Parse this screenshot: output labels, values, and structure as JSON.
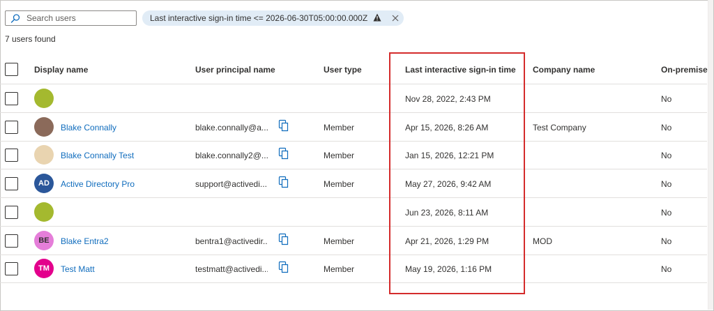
{
  "search": {
    "placeholder": "Search users",
    "icon": "search-icon"
  },
  "filter": {
    "text": "Last interactive sign-in time <= 2026-06-30T05:00:00.000Z",
    "warning_icon": "warning-icon",
    "close_icon": "close-icon"
  },
  "summary": {
    "count_text": "7 users found"
  },
  "columns": {
    "display_name": "Display name",
    "upn": "User principal name",
    "user_type": "User type",
    "last_signin": "Last interactive sign-in time",
    "company": "Company name",
    "onprem": "On-premises s"
  },
  "rows": [
    {
      "avatar_initials": "",
      "avatar_color": "#a4b92f",
      "avatar_text_color": "#ffffff",
      "name": "",
      "upn": "",
      "type": "",
      "signin": "Nov 28, 2022, 2:43 PM",
      "company": "",
      "onprem": "No"
    },
    {
      "avatar_initials": "",
      "avatar_color": "#8b6a5a",
      "avatar_text_color": "#ffffff",
      "name": "Blake Connally",
      "upn": "blake.connally@a...",
      "type": "Member",
      "signin": "Apr 15, 2026, 8:26 AM",
      "company": "Test Company",
      "onprem": "No"
    },
    {
      "avatar_initials": "",
      "avatar_color": "#e9d4b0",
      "avatar_text_color": "#ffffff",
      "name": "Blake Connally Test",
      "upn": "blake.connally2@...",
      "type": "Member",
      "signin": "Jan 15, 2026, 12:21 PM",
      "company": "",
      "onprem": "No"
    },
    {
      "avatar_initials": "AD",
      "avatar_color": "#2b579a",
      "avatar_text_color": "#ffffff",
      "name": "Active Directory Pro",
      "upn": "support@activedi...",
      "type": "Member",
      "signin": "May 27, 2026, 9:42 AM",
      "company": "",
      "onprem": "No"
    },
    {
      "avatar_initials": "",
      "avatar_color": "#a4b92f",
      "avatar_text_color": "#ffffff",
      "name": "",
      "upn": "",
      "type": "",
      "signin": "Jun 23, 2026, 8:11 AM",
      "company": "",
      "onprem": "No"
    },
    {
      "avatar_initials": "BE",
      "avatar_color": "#e57ed9",
      "avatar_text_color": "#323130",
      "name": "Blake Entra2",
      "upn": "bentra1@activedir...",
      "type": "Member",
      "signin": "Apr 21, 2026, 1:29 PM",
      "company": "MOD",
      "onprem": "No"
    },
    {
      "avatar_initials": "TM",
      "avatar_color": "#e3008c",
      "avatar_text_color": "#ffffff",
      "name": "Test Matt",
      "upn": "testmatt@activedi...",
      "type": "Member",
      "signin": "May 19, 2026, 1:16 PM",
      "company": "",
      "onprem": "No"
    }
  ],
  "colors": {
    "link": "#0f6cbd",
    "highlight_border": "#d42b2b",
    "filter_bg": "#e1ecf6"
  }
}
